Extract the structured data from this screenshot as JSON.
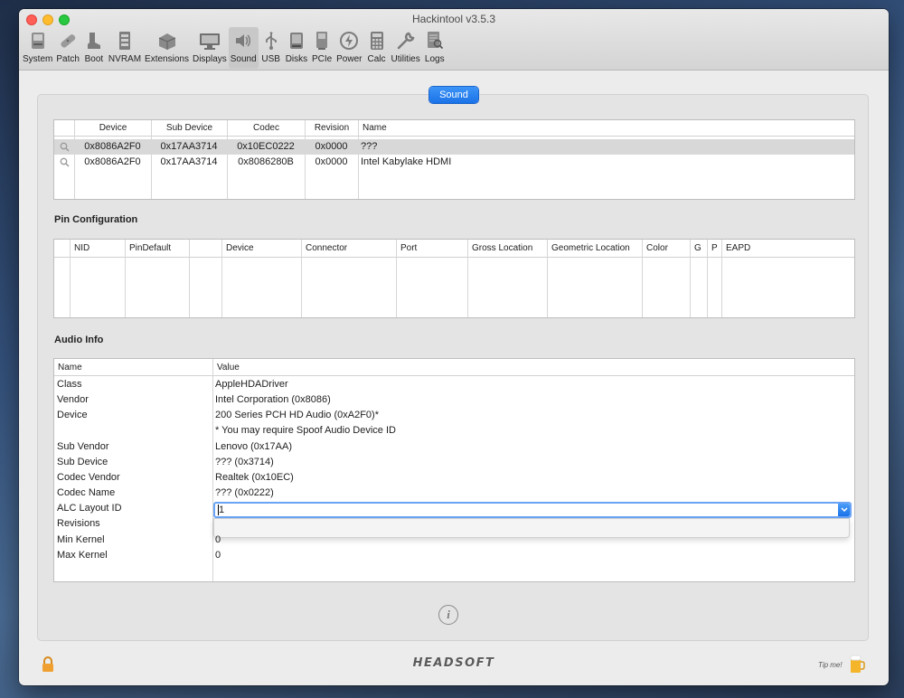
{
  "window": {
    "title": "Hackintool v3.5.3"
  },
  "toolbar": {
    "items": [
      {
        "label": "System",
        "icon": "system-icon"
      },
      {
        "label": "Patch",
        "icon": "patch-icon"
      },
      {
        "label": "Boot",
        "icon": "boot-icon"
      },
      {
        "label": "NVRAM",
        "icon": "nvram-icon"
      },
      {
        "label": "Extensions",
        "icon": "extensions-icon"
      },
      {
        "label": "Displays",
        "icon": "displays-icon"
      },
      {
        "label": "Sound",
        "icon": "sound-icon",
        "active": true
      },
      {
        "label": "USB",
        "icon": "usb-icon"
      },
      {
        "label": "Disks",
        "icon": "disks-icon"
      },
      {
        "label": "PCIe",
        "icon": "pcie-icon"
      },
      {
        "label": "Power",
        "icon": "power-icon"
      },
      {
        "label": "Calc",
        "icon": "calc-icon"
      },
      {
        "label": "Utilities",
        "icon": "utilities-icon"
      },
      {
        "label": "Logs",
        "icon": "logs-icon"
      }
    ]
  },
  "tab": {
    "label": "Sound"
  },
  "devices": {
    "columns": [
      "Device",
      "Sub Device",
      "Codec",
      "Revision",
      "Name"
    ],
    "rows": [
      {
        "device": "0x8086A2F0",
        "sub_device": "0x17AA3714",
        "codec": "0x10EC0222",
        "revision": "0x0000",
        "name": "???",
        "selected": true
      },
      {
        "device": "0x8086A2F0",
        "sub_device": "0x17AA3714",
        "codec": "0x8086280B",
        "revision": "0x0000",
        "name": "Intel Kabylake HDMI",
        "selected": false
      }
    ]
  },
  "pin_config": {
    "title": "Pin Configuration",
    "columns": [
      "NID",
      "PinDefault",
      "",
      "Device",
      "Connector",
      "Port",
      "Gross Location",
      "Geometric Location",
      "Color",
      "G",
      "P",
      "EAPD"
    ]
  },
  "audio_info": {
    "title": "Audio Info",
    "columns": [
      "Name",
      "Value"
    ],
    "rows": [
      {
        "name": "Class",
        "value": "AppleHDADriver"
      },
      {
        "name": "Vendor",
        "value": "Intel Corporation (0x8086)"
      },
      {
        "name": "Device",
        "value": "200 Series PCH HD Audio (0xA2F0)*"
      },
      {
        "name": "",
        "value": "* You may require Spoof Audio Device ID"
      },
      {
        "name": "Sub Vendor",
        "value": "Lenovo (0x17AA)"
      },
      {
        "name": "Sub Device",
        "value": "??? (0x3714)"
      },
      {
        "name": "Codec Vendor",
        "value": "Realtek (0x10EC)"
      },
      {
        "name": "Codec Name",
        "value": "??? (0x0222)"
      },
      {
        "name": "ALC Layout ID",
        "value": "1"
      },
      {
        "name": "Revisions",
        "value": ""
      },
      {
        "name": "Min Kernel",
        "value": "0"
      },
      {
        "name": "Max Kernel",
        "value": "0"
      }
    ]
  },
  "footer": {
    "brand": "HEADSOFT",
    "tip": "Tip me!"
  },
  "colors": {
    "accent": "#1a72e8",
    "selection": "#d8d8d8"
  }
}
